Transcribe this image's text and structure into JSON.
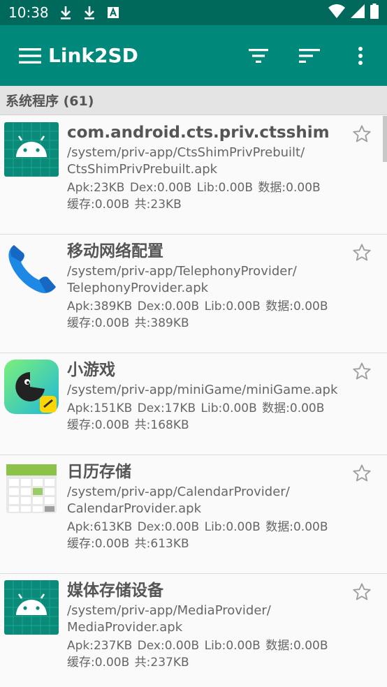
{
  "status_bar": {
    "time": "10:38",
    "icons_left": [
      "download-icon",
      "download-icon",
      "font-a-icon"
    ],
    "icons_right": [
      "wifi-icon",
      "signal-icon",
      "battery-icon"
    ]
  },
  "toolbar": {
    "title": "Link2SD",
    "background": "#00897b",
    "status_background": "#00695c"
  },
  "section": {
    "label": "系统程序 (61)"
  },
  "apps": [
    {
      "name": "com.android.cts.priv.ctsshim",
      "path": "/system/priv-app/CtsShimPrivPrebuilt/\nCtsShimPrivPrebuilt.apk",
      "sizes": "Apk:23KB  Dex:0.00B  Lib:0.00B  数据:0.00B",
      "cache": "缓存:0.00B  共:23KB",
      "icon": "android-robot-icon"
    },
    {
      "name": "移动网络配置",
      "path": "/system/priv-app/TelephonyProvider/\nTelephonyProvider.apk",
      "sizes": "Apk:389KB  Dex:0.00B  Lib:0.00B  数据:0.00B",
      "cache": "缓存:0.00B  共:389KB",
      "icon": "phone-icon"
    },
    {
      "name": "小游戏",
      "path": "/system/priv-app/miniGame/miniGame.apk",
      "sizes": "Apk:151KB  Dex:17KB  Lib:0.00B  数据:0.00B",
      "cache": "缓存:0.00B  共:168KB",
      "icon": "minigame-icon"
    },
    {
      "name": "日历存储",
      "path": "/system/priv-app/CalendarProvider/\nCalendarProvider.apk",
      "sizes": "Apk:613KB  Dex:0.00B  Lib:0.00B  数据:0.00B",
      "cache": "缓存:0.00B  共:613KB",
      "icon": "calendar-icon"
    },
    {
      "name": "媒体存储设备",
      "path": "/system/priv-app/MediaProvider/\nMediaProvider.apk",
      "sizes": "Apk:237KB  Dex:0.00B  Lib:0.00B  数据:0.00B",
      "cache": "缓存:0.00B  共:237KB",
      "icon": "android-robot-icon"
    }
  ]
}
